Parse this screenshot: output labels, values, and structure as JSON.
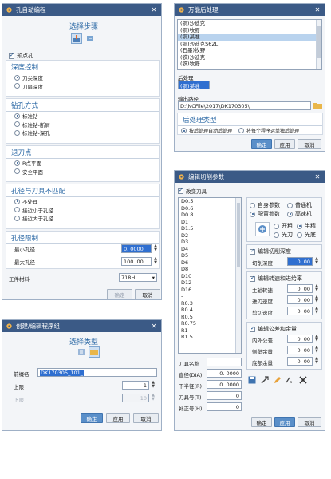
{
  "d1": {
    "title": "孔自动编程",
    "step_title": "选择步骤",
    "pre_hole_label": "预点孔",
    "depth_head": "深度控制",
    "depth_opts": [
      "刀尖深度",
      "刀肩深度"
    ],
    "drill_head": "钻孔方式",
    "drill_opts": [
      "标准钻",
      "标准钻-断屑",
      "标准钻-深孔"
    ],
    "retract_head": "退刀点",
    "retract_opts": [
      "R点平面",
      "安全平面"
    ],
    "mismatch_head": "孔径与刀具不匹配",
    "mismatch_opts": [
      "不处理",
      "接近小于孔径",
      "接近大于孔径"
    ],
    "limit_head": "孔径限制",
    "min_label": "最小孔径",
    "min_value": "0. 0000",
    "max_label": "最大孔径",
    "max_value": "100. 00",
    "material_label": "工件材料",
    "material_value": "718H",
    "ok": "确定",
    "cancel": "取消"
  },
  "d2": {
    "title": "万能后处理",
    "list": [
      "(铜)沙迪克",
      "(铜)牧野",
      "(铜)某准",
      "(铜)沙迪克S62L",
      "(石墨)牧野",
      "(铁)沙迪克",
      "(铁)牧野"
    ],
    "post_label": "后处理",
    "post_value": "(铜)某准",
    "out_label": "输出路径",
    "out_value": "D:\\NCFile\\2017\\DK170305\\",
    "type_head": "后处理类型",
    "type_opts": [
      "按后处理自动后处理",
      "将每个程序运单独后处理"
    ],
    "ok": "确定",
    "apply": "应用",
    "cancel": "取消"
  },
  "d3": {
    "title": "编辑切削参数",
    "change_tool": "改变刀具",
    "tools": [
      "D0.5",
      "D0.6",
      "D0.8",
      "D1",
      "D1.5",
      "D2",
      "D3",
      "D4",
      "D5",
      "D6",
      "D8",
      "D10",
      "D12",
      "D16",
      "-",
      "R0.3",
      "R0.4",
      "R0.5",
      "R0.75",
      "R1",
      "R1.5"
    ],
    "param_opts": [
      "自身参数",
      "普通机",
      "配置参数",
      "高速机"
    ],
    "finish_opts": [
      "开粗",
      "半精",
      "光刀",
      "光底"
    ],
    "edit_depth": "编辑切削深度",
    "cut_depth_label": "切削深度",
    "cut_depth_value": "0. 00",
    "edit_speed": "编辑转速和进给率",
    "spindle_label": "主轴转速",
    "spindle_value": "0. 00",
    "feed_label": "进刀速度",
    "feed_value": "0. 00",
    "cut_speed_label": "剪切速度",
    "cut_speed_value": "0. 00",
    "edit_tol": "编辑公差和余量",
    "inner_label": "内外公差",
    "inner_value": "0. 00",
    "side_label": "侧壁余量",
    "side_value": "0. 00",
    "bottom_label": "底部余量",
    "bottom_value": "0. 00",
    "toolname_label": "刀具名称",
    "dia_label": "直径(DIA)",
    "dia_value": "0. 0000",
    "corner_label": "下半径(R)",
    "corner_value": "0. 0000",
    "toolnum_label": "刀具号(T)",
    "toolnum_value": "0",
    "comp_label": "补正号(H)",
    "comp_value": "0",
    "ok": "确定",
    "apply": "应用",
    "cancel": "取消"
  },
  "d4": {
    "title": "创建/编辑程序组",
    "type_title": "选择类型",
    "prefix_label": "前缀名",
    "prefix_value": "DK170305_101_",
    "upper_label": "上限",
    "upper_value": "1",
    "lower_label": "下限",
    "lower_value": "10",
    "ok": "确定",
    "apply": "应用",
    "cancel": "取消"
  }
}
